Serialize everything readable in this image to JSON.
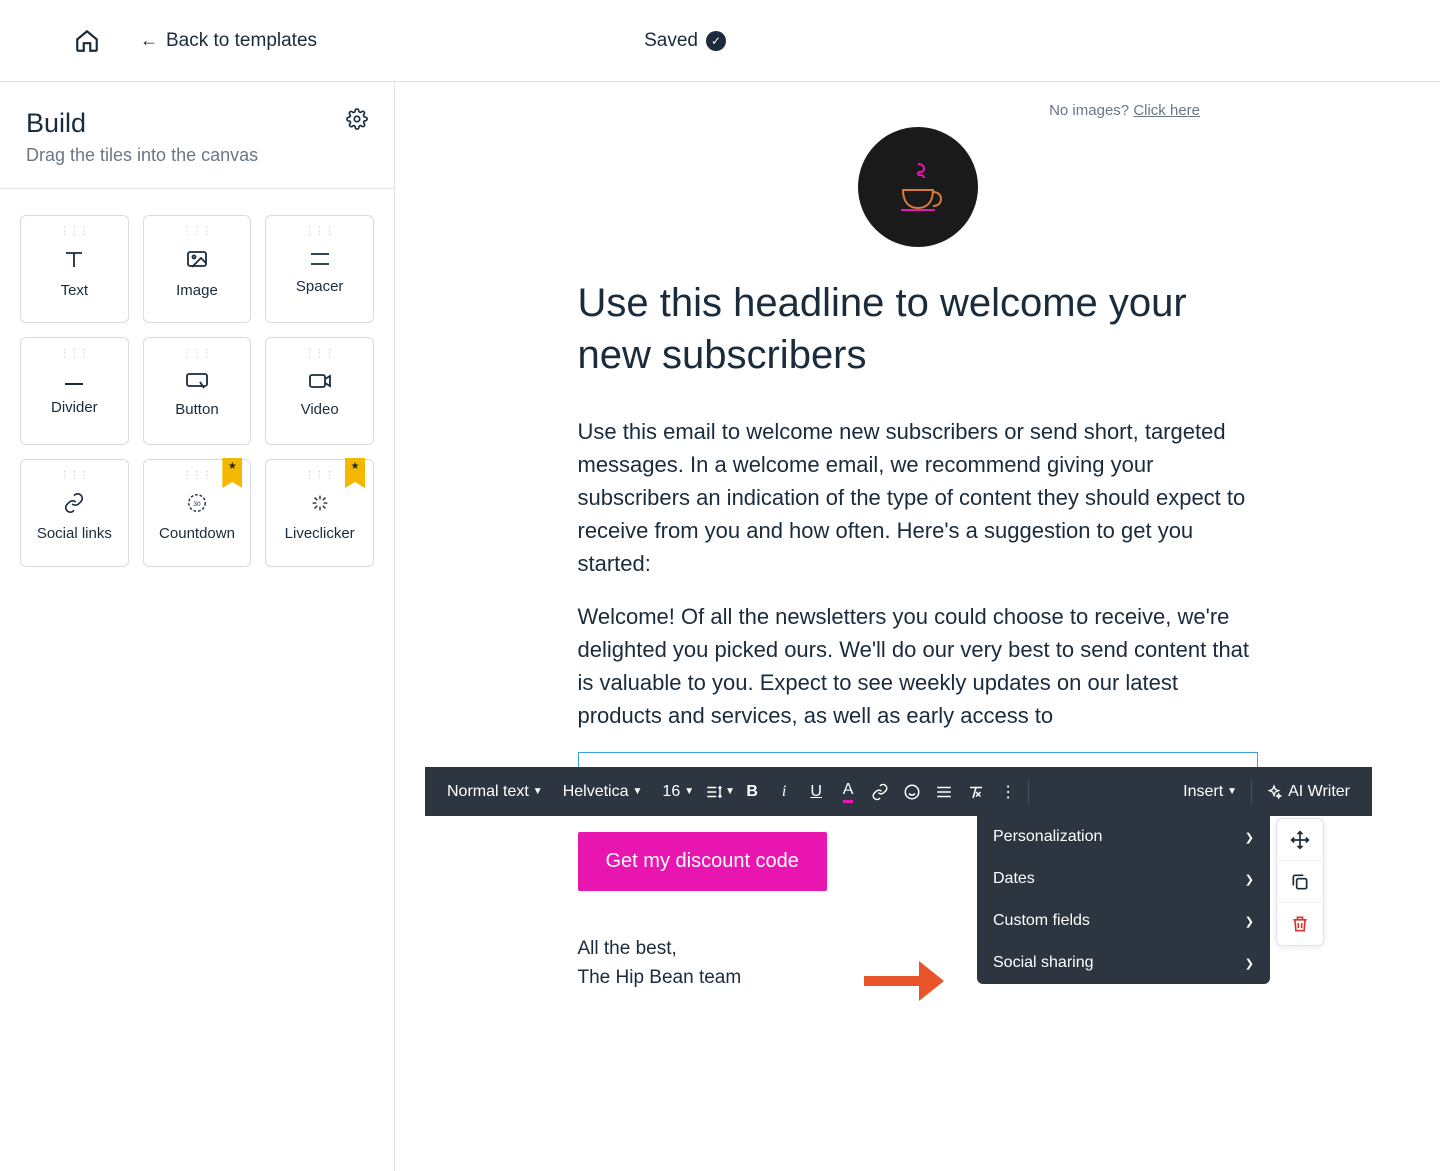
{
  "topbar": {
    "back_label": "Back to templates",
    "saved_label": "Saved"
  },
  "sidebar": {
    "title": "Build",
    "subtitle": "Drag the tiles into the canvas",
    "tiles": [
      {
        "label": "Text"
      },
      {
        "label": "Image"
      },
      {
        "label": "Spacer"
      },
      {
        "label": "Divider"
      },
      {
        "label": "Button"
      },
      {
        "label": "Video"
      },
      {
        "label": "Social links"
      },
      {
        "label": "Countdown"
      },
      {
        "label": "Liveclicker"
      }
    ]
  },
  "canvas": {
    "no_images_text": "No images? ",
    "no_images_link": "Click here",
    "headline": "Use this headline to welcome your new subscribers",
    "para1": "Use this email to welcome new subscribers or send short, targeted messages. In a welcome email, we recommend giving your subscribers an indication of the type of content they should expect to receive from you and how often. Here's a suggestion to get you started:",
    "para2": "Welcome! Of all the newsletters you could choose to receive, we're delighted you picked ours. We'll do our very best to send content that is valuable to you. Expect to see weekly updates on our latest products and services, as well as early access to",
    "cta": "Get my discount code",
    "closing1": "All the best,",
    "closing2": "The Hip Bean team"
  },
  "toolbar": {
    "style": "Normal text",
    "font": "Helvetica",
    "size": "16",
    "insert_label": "Insert",
    "ai_label": "AI Writer"
  },
  "dropdown": {
    "items": [
      "Personalization",
      "Dates",
      "Custom fields",
      "Social sharing"
    ]
  }
}
